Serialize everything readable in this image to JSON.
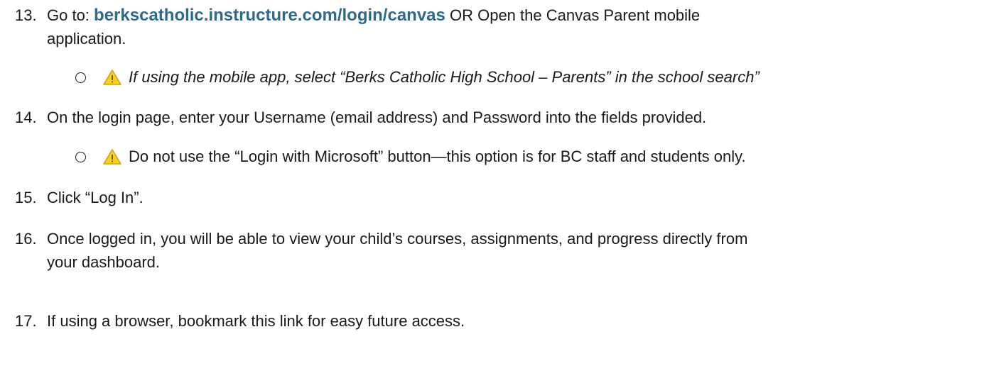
{
  "steps": [
    {
      "number": "13.",
      "prefix": "Go to: ",
      "link": "berkscatholic.instructure.com/login/canvas",
      "suffix": " OR Open the Canvas Parent mobile",
      "continuation": "application.",
      "note": "If using the mobile app, select “Berks Catholic High School – Parents” in the school search”"
    },
    {
      "number": "14.",
      "text": "On the login page, enter your Username (email address) and Password into the fields provided.",
      "note": "Do not use the “Login with Microsoft” button—this option is for BC staff and students only."
    },
    {
      "number": "15.",
      "text": "Click “Log In”."
    },
    {
      "number": "16.",
      "text": "Once logged in, you will be able to view your child’s courses, assignments, and progress directly from",
      "continuation": "your dashboard."
    },
    {
      "number": "17.",
      "text": "If using a browser, bookmark this link for easy future access."
    }
  ],
  "icons": {
    "warning": "warning-triangle-icon",
    "bullet": "hollow-circle-bullet"
  },
  "colors": {
    "link": "#2d6a8e",
    "warning_fill": "#f7d21e",
    "warning_stroke": "#d4a400",
    "text": "#1a1a1a"
  }
}
